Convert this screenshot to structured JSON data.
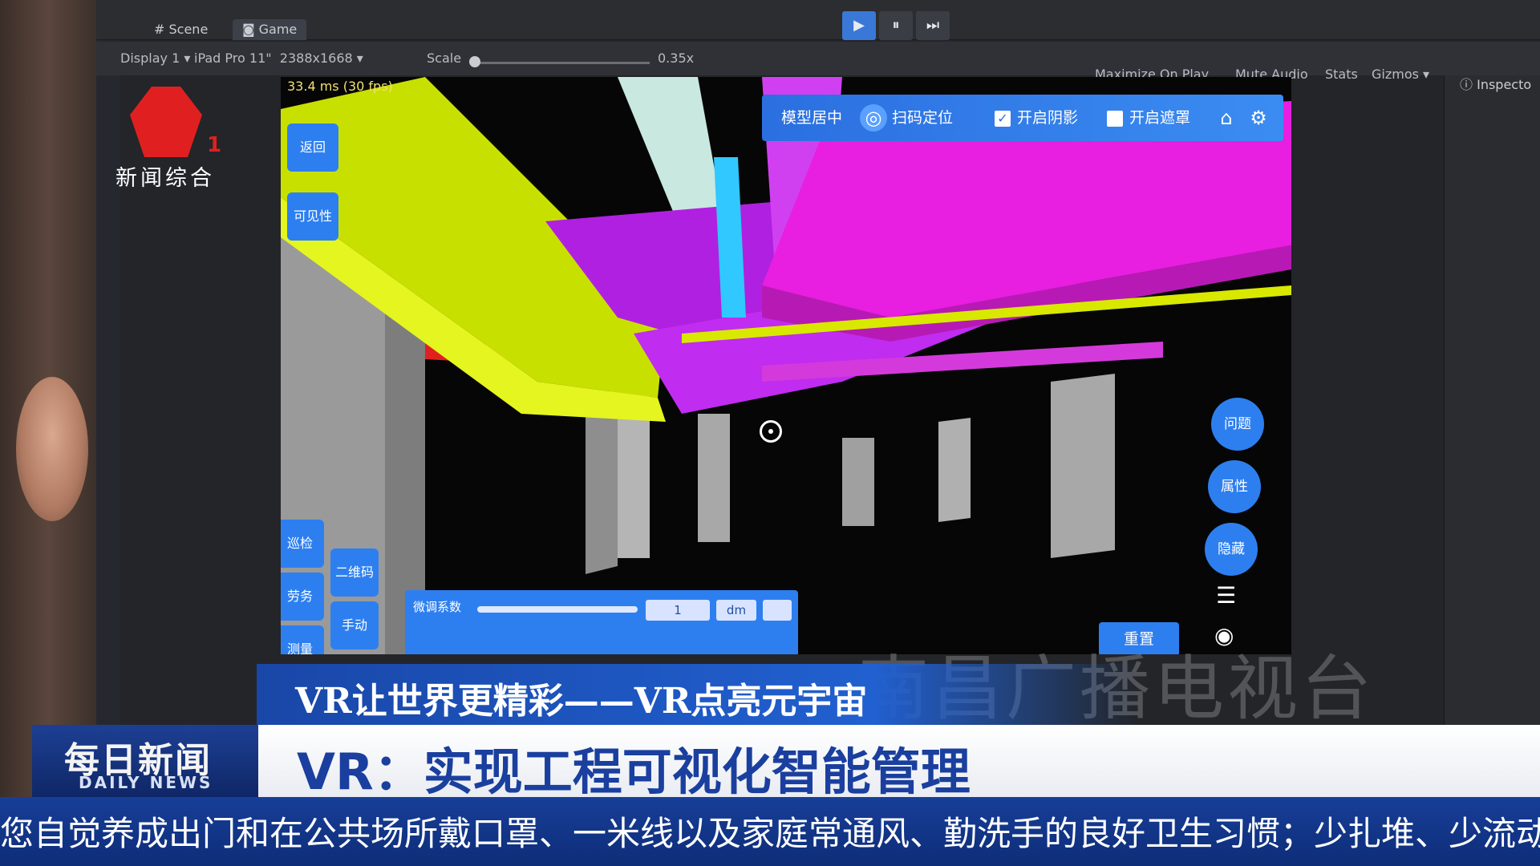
{
  "unity": {
    "tabs": {
      "scene": "Scene",
      "game": "Game"
    },
    "controls": {
      "play": "▶",
      "pause": "⏸",
      "step": "⏭"
    },
    "game_bar": {
      "display": "Display 1",
      "device": "iPad Pro 11\"",
      "resolution": "2388x1668",
      "scale_label": "Scale",
      "scale_value": "0.35x",
      "maximize": "Maximize On Play",
      "mute": "Mute Audio",
      "stats": "Stats",
      "gizmos": "Gizmos"
    },
    "inspector": "Inspecto"
  },
  "viewport": {
    "fps": "33.4 ms (30 fps)",
    "toolbar": {
      "model_center": "模型居中",
      "scan_locate": "扫码定位",
      "shadow": "开启阴影",
      "occlusion": "开启遮罩"
    },
    "left_buttons": {
      "back": "返回",
      "visibility": "可见性"
    },
    "bottom_left_buttons": {
      "patrol": "巡检",
      "labor": "劳务",
      "measure": "测量",
      "qrcode": "二维码",
      "manual": "手动"
    },
    "bottom_panel": {
      "label": "微调系数",
      "value": "1",
      "unit": "dm"
    },
    "right_buttons": {
      "issue": "问题",
      "property": "属性",
      "hide": "隐藏"
    },
    "reset": "重置",
    "colors": {
      "accent": "#2d7ff0",
      "yellow": "#d7f000",
      "magenta": "#e020e0",
      "red": "#e02020"
    }
  },
  "station": {
    "name": "新闻综合",
    "number": "1"
  },
  "watermark": "南昌广播电视台",
  "news": {
    "subtitle": "VR让世界更精彩——VR点亮元宇宙",
    "program_cn": "每日新闻",
    "program_en": "DAILY NEWS",
    "headline": "VR：实现工程可视化智能管理",
    "ticker": "您自觉养成出门和在公共场所戴口罩、一米线以及家庭常通风、勤洗手的良好卫生习惯；少扎堆、少流动"
  }
}
